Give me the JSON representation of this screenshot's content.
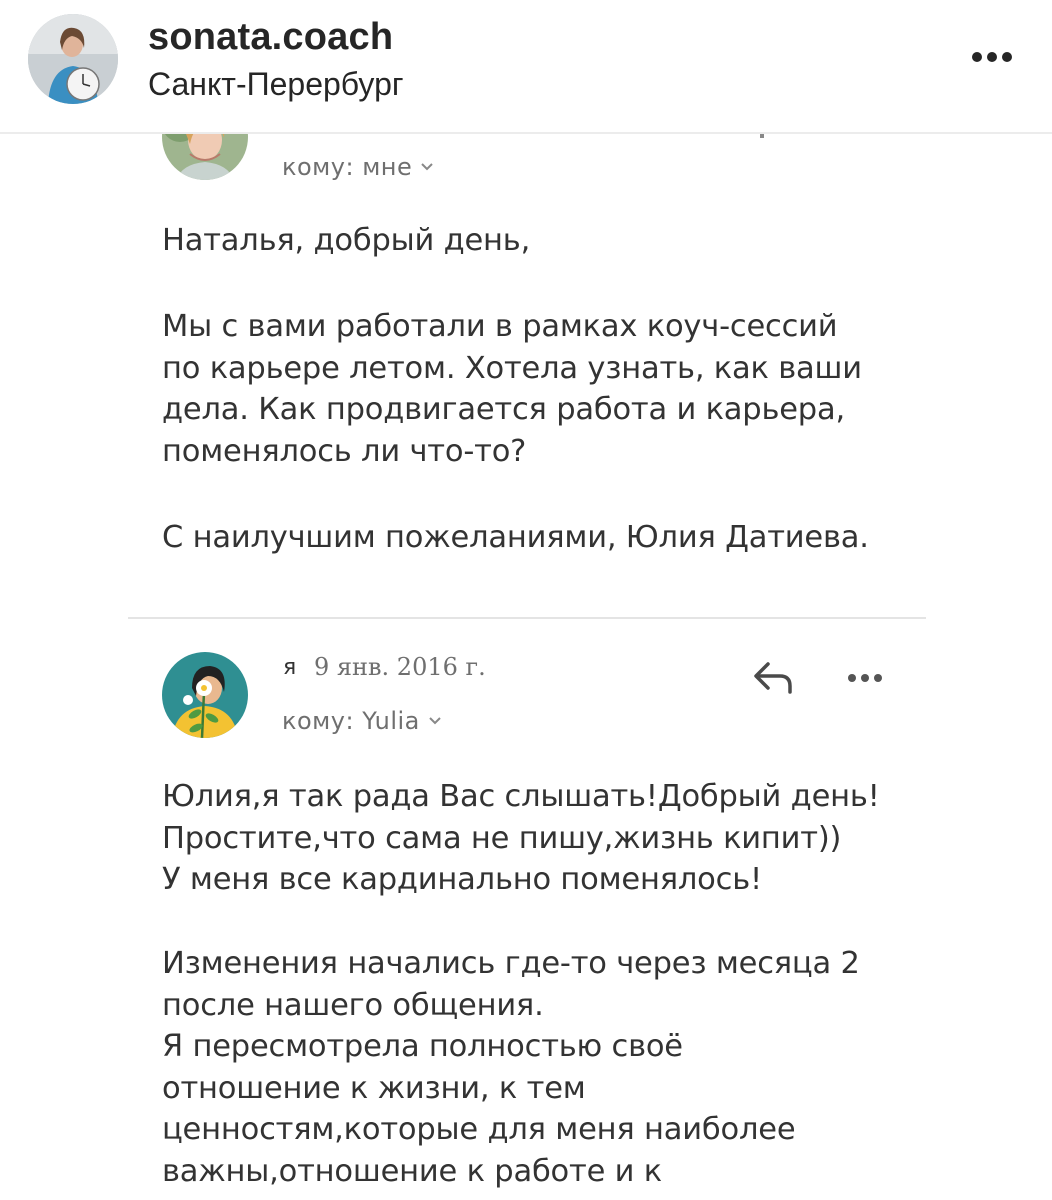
{
  "post": {
    "username": "sonata.coach",
    "location": "Санкт-Перербург"
  },
  "email": {
    "first_message": {
      "recipient": "кому: мне",
      "paragraphs": [
        "Наталья, добрый день,",
        "Мы с вами работали в рамках коуч-сессий\nпо карьере летом. Хотела узнать, как ваши\nдела. Как продвигается работа и карьера,\nпоменялось ли что-то?",
        "С наилучшим пожеланиями, Юлия Датиева."
      ]
    },
    "second_message": {
      "sender": "я",
      "date": "9 янв. 2016 г.",
      "recipient": "кому: Yulia",
      "paragraphs": [
        "Юлия,я так рада Вас слышать!Добрый день!\nПростите,что сама не пишу,жизнь кипит))\nУ меня все кардинально поменялось!",
        "Изменения начались где-то через месяца 2\nпосле нашего общения.\nЯ пересмотрела полностью своё\nотношение к жизни, к тем\nценностям,которые для меня наиболее\nважны,отношение к работе и к"
      ]
    }
  },
  "icons": {
    "post_menu": "more-horizontal-icon",
    "reply": "reply-arrow-icon",
    "message_menu": "more-horizontal-icon",
    "recipient_dropdown": "chevron-down-icon"
  },
  "colors": {
    "text_primary": "#262626",
    "text_secondary": "#6f6f6f",
    "divider": "#e4e4e4"
  }
}
